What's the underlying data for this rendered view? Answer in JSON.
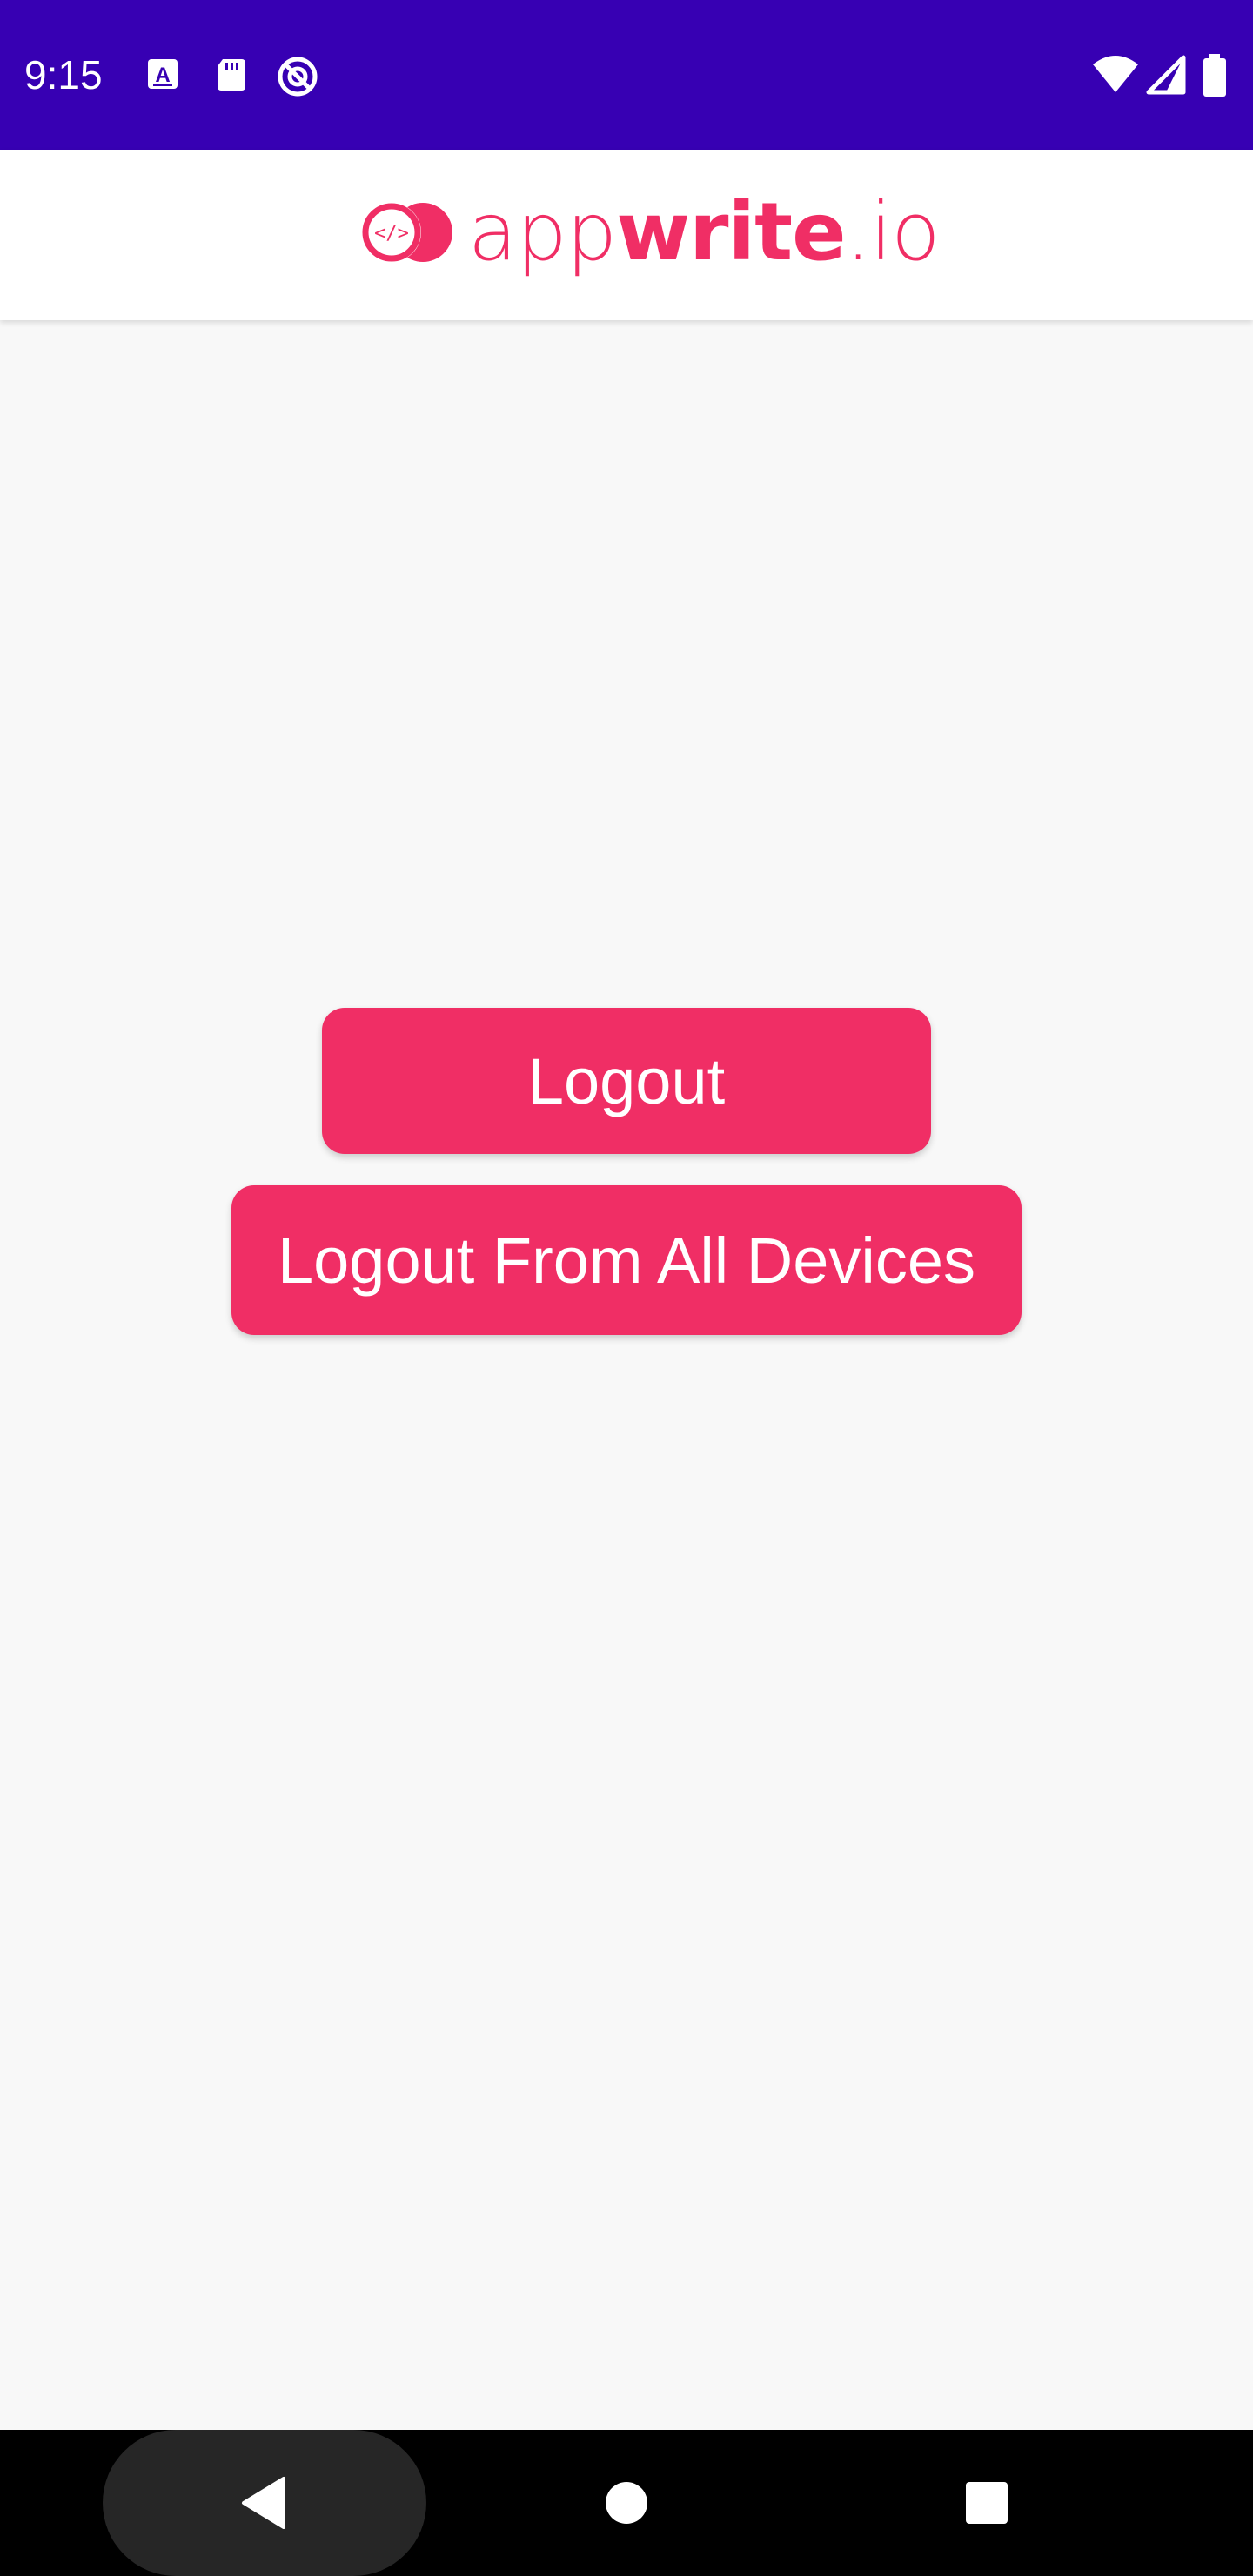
{
  "status_bar": {
    "time": "9:15",
    "background_color": "#3700b3",
    "left_icons": [
      "keyboard-a-icon",
      "sd-card-icon",
      "do-not-disturb-icon"
    ],
    "right_icons": [
      "wifi-icon",
      "cellular-signal-icon",
      "battery-icon"
    ]
  },
  "app_bar": {
    "logo": {
      "text_light": "app",
      "text_bold": "write",
      "text_tld": ".io",
      "brand_color": "#f02e65"
    }
  },
  "main": {
    "logout_label": "Logout",
    "logout_all_label": "Logout From All Devices",
    "button_color": "#f02e65"
  },
  "nav_bar": {
    "buttons": [
      "back-icon",
      "home-icon",
      "recents-icon"
    ]
  }
}
